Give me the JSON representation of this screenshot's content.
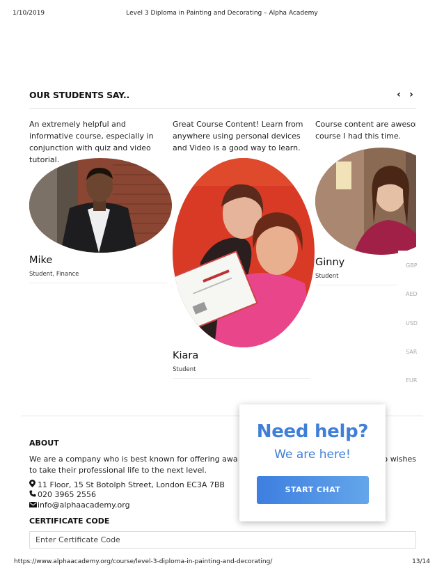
{
  "print_header": {
    "date": "1/10/2019",
    "title": "Level 3 Diploma in Painting and Decorating – Alpha Academy"
  },
  "testimonials": {
    "section_title": "OUR STUDENTS SAY..",
    "prev_glyph": "‹",
    "next_glyph": "›",
    "cards": [
      {
        "quote": "An extremely helpful and informative course, especially in conjunction with quiz and video tutorial.",
        "name": "Mike",
        "role": "Student, Finance"
      },
      {
        "quote": "Great Course Content! Learn from anywhere using personal devices and Video is a good way to learn.",
        "name": "Kiara",
        "role": "Student"
      },
      {
        "quote": "Course content are awesome, the best course I had this time.",
        "name": "Ginny",
        "role": "Student"
      }
    ]
  },
  "currencies": [
    "GBP",
    "AED",
    "USD",
    "SAR",
    "EUR"
  ],
  "about": {
    "title": "ABOUT",
    "text": "We are a company who is best known for offering awa                                               one who wishes to take their professional life to the next level.",
    "address": "11 Floor, 15 St Botolph Street, London EC3A 7BB",
    "phone": "020 3965 2556",
    "email": "info@alphaacademy.org"
  },
  "certificate": {
    "title": "CERTIFICATE CODE",
    "placeholder": "Enter Certificate Code"
  },
  "help_widget": {
    "heading": "Need help?",
    "subheading": "We are here!",
    "button_label": "START CHAT"
  },
  "print_footer": {
    "url": "https://www.alphaacademy.org/course/level-3-diploma-in-painting-and-decorating/",
    "page": "13/14"
  },
  "colors": {
    "accent_blue": "#3f7fd8",
    "button_gradient_start": "#3d7ee0",
    "button_gradient_end": "#64a6ea"
  }
}
